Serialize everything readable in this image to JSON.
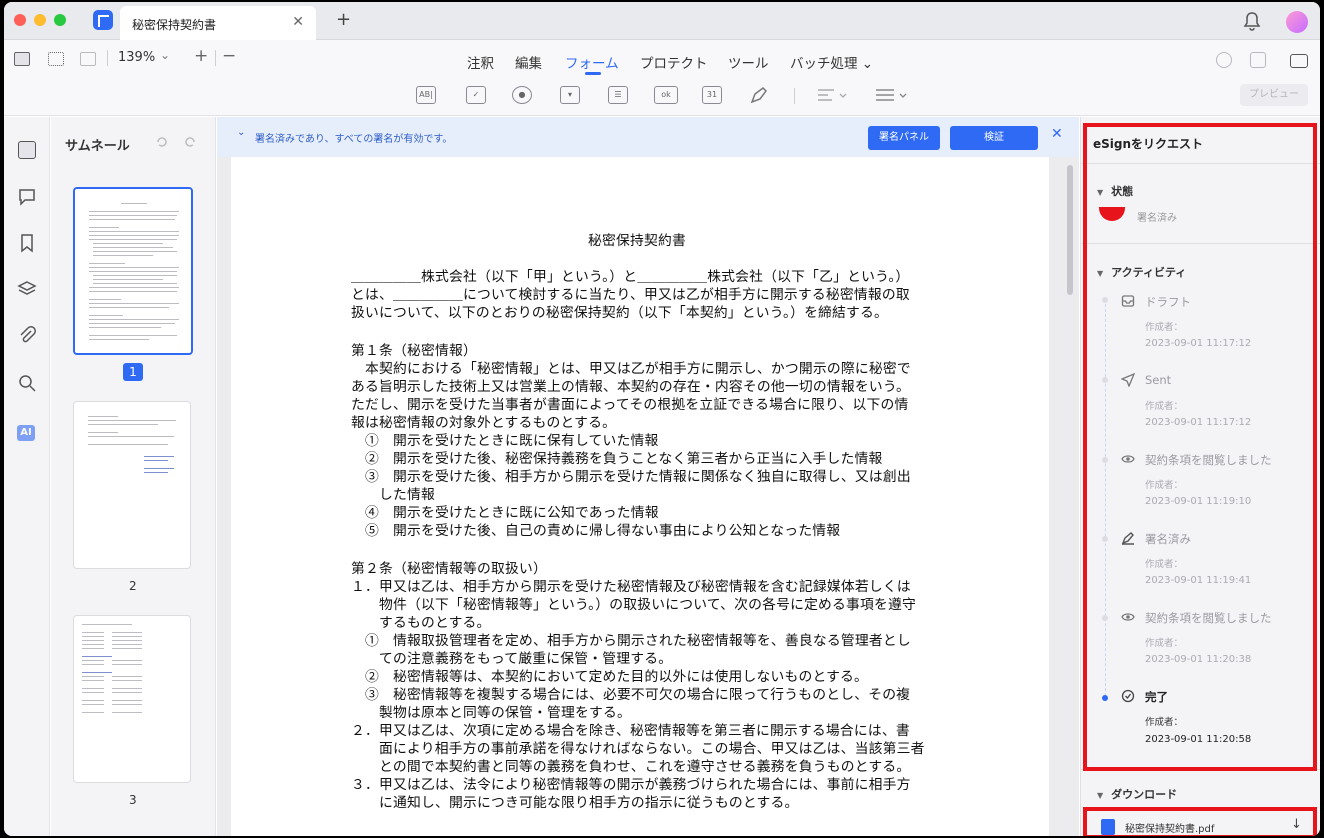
{
  "tab": {
    "title": "秘密保持契約書",
    "close": "✕",
    "new": "+"
  },
  "toolbar": {
    "zoom": "139%",
    "zoom_caret": "⌄",
    "plus": "+",
    "minus": "−",
    "menus": [
      "注釈",
      "編集",
      "フォーム",
      "プロテクト",
      "ツール",
      "バッチ処理 ⌄"
    ],
    "active_menu": "フォーム",
    "form_tools": [
      "AB|",
      "✓",
      "●",
      "▾",
      "☰",
      "ok",
      "31"
    ],
    "preview": "プレビュー"
  },
  "thumbnails": {
    "title": "サムネール",
    "pages": [
      "1",
      "2",
      "3"
    ]
  },
  "signature_bar": {
    "caret": "⌄",
    "message": "署名済みであり、すべての署名が有効です。",
    "panel_button": "署名パネル",
    "verify_button": "検証",
    "close": "✕"
  },
  "document": {
    "title": "秘密保持契約書",
    "lines": [
      "＿＿＿＿＿株式会社（以下「甲」という。）と＿＿＿＿＿株式会社（以下「乙」という。）",
      "とは、＿＿＿＿＿について検討するに当たり、甲又は乙が相手方に開示する秘密情報の取",
      "扱いについて、以下のとおりの秘密保持契約（以下「本契約」という。）を締結する。",
      "第１条（秘密情報）",
      "　本契約における「秘密情報」とは、甲又は乙が相手方に開示し、かつ開示の際に秘密で",
      "ある旨明示した技術上又は営業上の情報、本契約の存在・内容その他一切の情報をいう。",
      "ただし、開示を受けた当事者が書面によってその根拠を立証できる場合に限り、以下の情",
      "報は秘密情報の対象外とするものとする。",
      "　①　開示を受けたときに既に保有していた情報",
      "　②　開示を受けた後、秘密保持義務を負うことなく第三者から正当に入手した情報",
      "　③　開示を受けた後、相手方から開示を受けた情報に関係なく独自に取得し、又は創出",
      "　　した情報",
      "　④　開示を受けたときに既に公知であった情報",
      "　⑤　開示を受けた後、自己の責めに帰し得ない事由により公知となった情報",
      "第２条（秘密情報等の取扱い）",
      "１．甲又は乙は、相手方から開示を受けた秘密情報及び秘密情報を含む記録媒体若しくは",
      "　　物件（以下「秘密情報等」という。）の取扱いについて、次の各号に定める事項を遵守",
      "　　するものとする。",
      "　①　情報取扱管理者を定め、相手方から開示された秘密情報等を、善良なる管理者とし",
      "　　ての注意義務をもって厳重に保管・管理する。",
      "　②　秘密情報等は、本契約において定めた目的以外には使用しないものとする。",
      "　③　秘密情報等を複製する場合には、必要不可欠の場合に限って行うものとし、その複",
      "　　製物は原本と同等の保管・管理をする。",
      "２．甲又は乙は、次項に定める場合を除き、秘密情報等を第三者に開示する場合には、書",
      "　　面により相手方の事前承諾を得なければならない。この場合、甲又は乙は、当該第三者",
      "　　との間で本契約書と同等の義務を負わせ、これを遵守させる義務を負うものとする。",
      "３．甲又は乙は、法令により秘密情報等の開示が義務づけられた場合には、事前に相手方",
      "　　に通知し、開示につき可能な限り相手方の指示に従うものとする。"
    ]
  },
  "esign": {
    "title": "eSignをリクエスト",
    "status_section": "状態",
    "status": "署名済み",
    "activity_section": "アクティビティ",
    "caret": "▼",
    "activities": [
      {
        "name": "ドラフト",
        "by": "作成者：",
        "time": "2023-09-01 11:17:12",
        "icon": "inbox-icon"
      },
      {
        "name": "Sent",
        "by": "作成者：",
        "time": "2023-09-01 11:17:12",
        "icon": "send-icon"
      },
      {
        "name": "契約条項を閲覧しました",
        "by": "作成者：",
        "time": "2023-09-01 11:19:10",
        "icon": "eye-icon"
      },
      {
        "name": "署名済み",
        "by": "作成者：",
        "time": "2023-09-01 11:19:41",
        "icon": "signature-icon"
      },
      {
        "name": "契約条項を閲覧しました",
        "by": "作成者：",
        "time": "2023-09-01 11:20:38",
        "icon": "eye-icon"
      },
      {
        "name": "完了",
        "by": "作成者：",
        "time": "2023-09-01 11:20:58",
        "icon": "check-circle-icon"
      }
    ],
    "download_section": "ダウンロード",
    "download_file": "秘密保持契約書.pdf",
    "download_arrow": "↓"
  },
  "colors": {
    "accent": "#2f6af5",
    "highlight": "#e8141c"
  }
}
